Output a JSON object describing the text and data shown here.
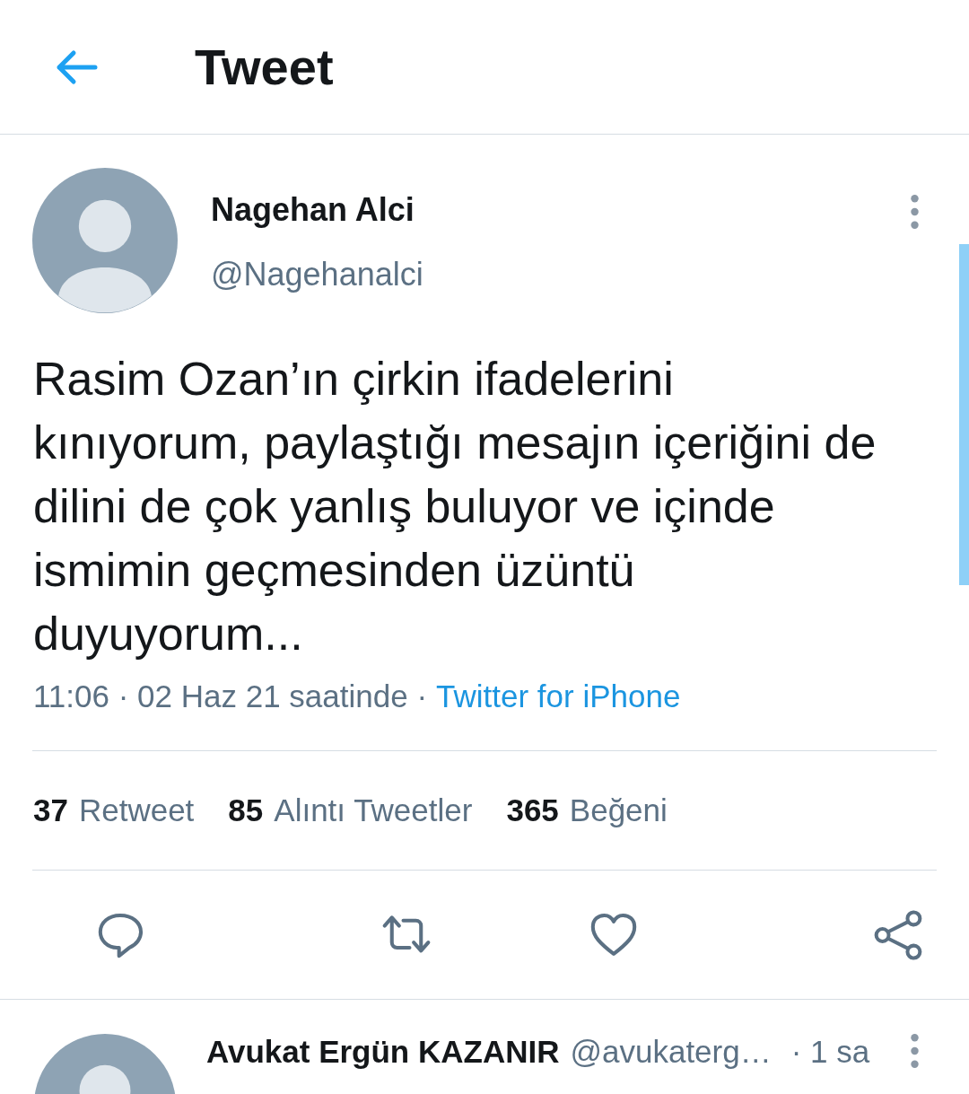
{
  "header": {
    "title": "Tweet"
  },
  "tweet": {
    "author": "Nagehan Alci",
    "handle": "@Nagehanalci",
    "text": "Rasim Ozan’ın çirkin ifadelerini kınıyorum, paylaştığı mesajın içeriğini de dilini de çok yanlış buluyor ve içinde ismimin geçmesinden üzüntü duyuyorum...",
    "meta": "11:06 · 02 Haz 21 saatinde ·",
    "source": "Twitter for iPhone"
  },
  "stats": [
    {
      "count": "37",
      "label": "Retweet"
    },
    {
      "count": "85",
      "label": "Alıntı Tweetler"
    },
    {
      "count": "365",
      "label": "Beğeni"
    }
  ],
  "actions": [
    {
      "kind": "reply"
    },
    {
      "kind": "retweet"
    },
    {
      "kind": "like"
    },
    {
      "kind": "share"
    }
  ],
  "reply": {
    "author": "Avukat Ergün KAZANIR",
    "handle": "@avukaterg…",
    "time": "· 1 sa"
  }
}
